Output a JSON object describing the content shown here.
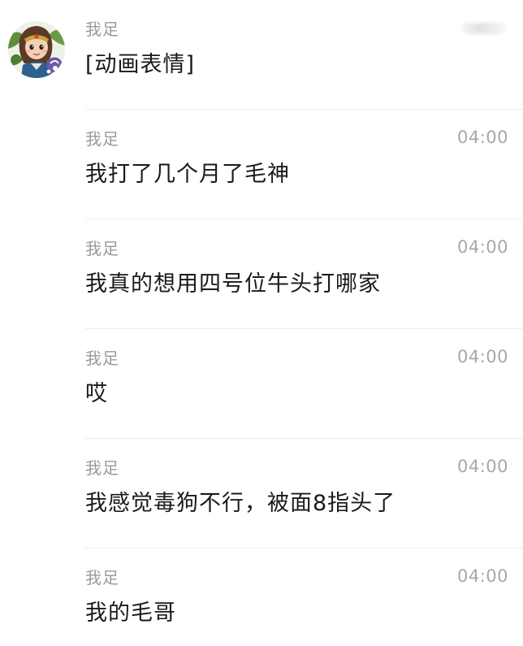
{
  "messages": [
    {
      "sender": "我足",
      "text": "[动画表情]",
      "time": ""
    },
    {
      "sender": "我足",
      "text": "我打了几个月了毛神",
      "time": "04:00"
    },
    {
      "sender": "我足",
      "text": "我真的想用四号位牛头打哪家",
      "time": "04:00"
    },
    {
      "sender": "我足",
      "text": "哎",
      "time": "04:00"
    },
    {
      "sender": "我足",
      "text": "我感觉毒狗不行，被面8指头了",
      "time": "04:00"
    },
    {
      "sender": "我足",
      "text": "我的毛哥",
      "time": "04:00"
    }
  ]
}
